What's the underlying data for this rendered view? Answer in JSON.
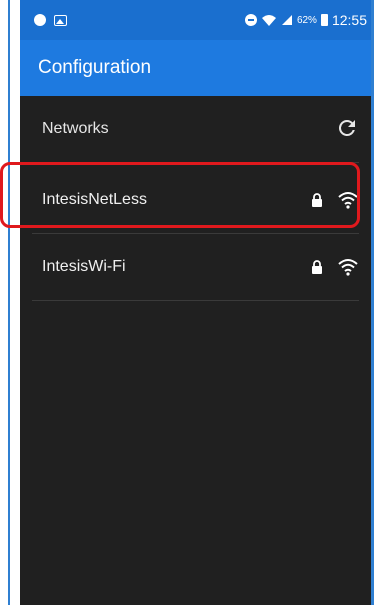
{
  "status_bar": {
    "battery": "62%",
    "time": "12:55",
    "icons": [
      "notification-dot-icon",
      "image-icon",
      "do-not-disturb-icon",
      "wifi-icon",
      "signal-icon",
      "battery-icon"
    ]
  },
  "app_bar": {
    "title": "Configuration"
  },
  "networks": {
    "header_label": "Networks",
    "refresh_icon": "refresh-icon",
    "items": [
      {
        "ssid": "IntesisNetLess",
        "secured": true,
        "icons": [
          "lock-icon",
          "wifi-icon"
        ],
        "highlighted": true
      },
      {
        "ssid": "IntesisWi-Fi",
        "secured": true,
        "icons": [
          "lock-icon",
          "wifi-icon"
        ],
        "highlighted": false
      }
    ]
  },
  "colors": {
    "status_bar": "#1a6fcf",
    "app_bar": "#1e7ae0",
    "background": "#202020",
    "highlight": "#e0191d",
    "frame_line": "#2f7fd1"
  }
}
